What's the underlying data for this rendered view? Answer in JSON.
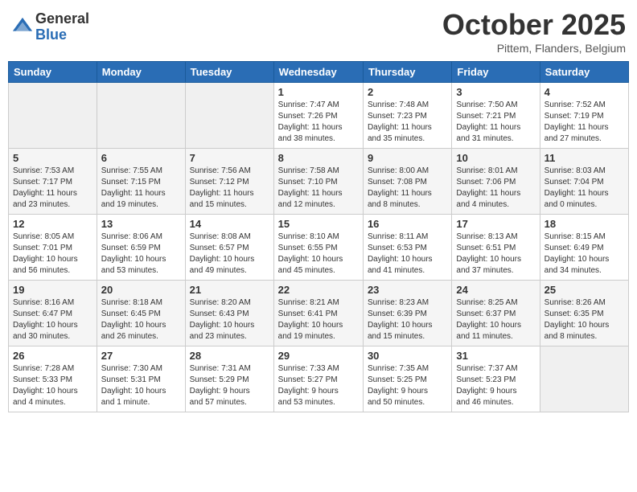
{
  "logo": {
    "general": "General",
    "blue": "Blue"
  },
  "title": "October 2025",
  "subtitle": "Pittem, Flanders, Belgium",
  "weekdays": [
    "Sunday",
    "Monday",
    "Tuesday",
    "Wednesday",
    "Thursday",
    "Friday",
    "Saturday"
  ],
  "weeks": [
    [
      {
        "day": "",
        "info": ""
      },
      {
        "day": "",
        "info": ""
      },
      {
        "day": "",
        "info": ""
      },
      {
        "day": "1",
        "info": "Sunrise: 7:47 AM\nSunset: 7:26 PM\nDaylight: 11 hours\nand 38 minutes."
      },
      {
        "day": "2",
        "info": "Sunrise: 7:48 AM\nSunset: 7:23 PM\nDaylight: 11 hours\nand 35 minutes."
      },
      {
        "day": "3",
        "info": "Sunrise: 7:50 AM\nSunset: 7:21 PM\nDaylight: 11 hours\nand 31 minutes."
      },
      {
        "day": "4",
        "info": "Sunrise: 7:52 AM\nSunset: 7:19 PM\nDaylight: 11 hours\nand 27 minutes."
      }
    ],
    [
      {
        "day": "5",
        "info": "Sunrise: 7:53 AM\nSunset: 7:17 PM\nDaylight: 11 hours\nand 23 minutes."
      },
      {
        "day": "6",
        "info": "Sunrise: 7:55 AM\nSunset: 7:15 PM\nDaylight: 11 hours\nand 19 minutes."
      },
      {
        "day": "7",
        "info": "Sunrise: 7:56 AM\nSunset: 7:12 PM\nDaylight: 11 hours\nand 15 minutes."
      },
      {
        "day": "8",
        "info": "Sunrise: 7:58 AM\nSunset: 7:10 PM\nDaylight: 11 hours\nand 12 minutes."
      },
      {
        "day": "9",
        "info": "Sunrise: 8:00 AM\nSunset: 7:08 PM\nDaylight: 11 hours\nand 8 minutes."
      },
      {
        "day": "10",
        "info": "Sunrise: 8:01 AM\nSunset: 7:06 PM\nDaylight: 11 hours\nand 4 minutes."
      },
      {
        "day": "11",
        "info": "Sunrise: 8:03 AM\nSunset: 7:04 PM\nDaylight: 11 hours\nand 0 minutes."
      }
    ],
    [
      {
        "day": "12",
        "info": "Sunrise: 8:05 AM\nSunset: 7:01 PM\nDaylight: 10 hours\nand 56 minutes."
      },
      {
        "day": "13",
        "info": "Sunrise: 8:06 AM\nSunset: 6:59 PM\nDaylight: 10 hours\nand 53 minutes."
      },
      {
        "day": "14",
        "info": "Sunrise: 8:08 AM\nSunset: 6:57 PM\nDaylight: 10 hours\nand 49 minutes."
      },
      {
        "day": "15",
        "info": "Sunrise: 8:10 AM\nSunset: 6:55 PM\nDaylight: 10 hours\nand 45 minutes."
      },
      {
        "day": "16",
        "info": "Sunrise: 8:11 AM\nSunset: 6:53 PM\nDaylight: 10 hours\nand 41 minutes."
      },
      {
        "day": "17",
        "info": "Sunrise: 8:13 AM\nSunset: 6:51 PM\nDaylight: 10 hours\nand 37 minutes."
      },
      {
        "day": "18",
        "info": "Sunrise: 8:15 AM\nSunset: 6:49 PM\nDaylight: 10 hours\nand 34 minutes."
      }
    ],
    [
      {
        "day": "19",
        "info": "Sunrise: 8:16 AM\nSunset: 6:47 PM\nDaylight: 10 hours\nand 30 minutes."
      },
      {
        "day": "20",
        "info": "Sunrise: 8:18 AM\nSunset: 6:45 PM\nDaylight: 10 hours\nand 26 minutes."
      },
      {
        "day": "21",
        "info": "Sunrise: 8:20 AM\nSunset: 6:43 PM\nDaylight: 10 hours\nand 23 minutes."
      },
      {
        "day": "22",
        "info": "Sunrise: 8:21 AM\nSunset: 6:41 PM\nDaylight: 10 hours\nand 19 minutes."
      },
      {
        "day": "23",
        "info": "Sunrise: 8:23 AM\nSunset: 6:39 PM\nDaylight: 10 hours\nand 15 minutes."
      },
      {
        "day": "24",
        "info": "Sunrise: 8:25 AM\nSunset: 6:37 PM\nDaylight: 10 hours\nand 11 minutes."
      },
      {
        "day": "25",
        "info": "Sunrise: 8:26 AM\nSunset: 6:35 PM\nDaylight: 10 hours\nand 8 minutes."
      }
    ],
    [
      {
        "day": "26",
        "info": "Sunrise: 7:28 AM\nSunset: 5:33 PM\nDaylight: 10 hours\nand 4 minutes."
      },
      {
        "day": "27",
        "info": "Sunrise: 7:30 AM\nSunset: 5:31 PM\nDaylight: 10 hours\nand 1 minute."
      },
      {
        "day": "28",
        "info": "Sunrise: 7:31 AM\nSunset: 5:29 PM\nDaylight: 9 hours\nand 57 minutes."
      },
      {
        "day": "29",
        "info": "Sunrise: 7:33 AM\nSunset: 5:27 PM\nDaylight: 9 hours\nand 53 minutes."
      },
      {
        "day": "30",
        "info": "Sunrise: 7:35 AM\nSunset: 5:25 PM\nDaylight: 9 hours\nand 50 minutes."
      },
      {
        "day": "31",
        "info": "Sunrise: 7:37 AM\nSunset: 5:23 PM\nDaylight: 9 hours\nand 46 minutes."
      },
      {
        "day": "",
        "info": ""
      }
    ]
  ]
}
